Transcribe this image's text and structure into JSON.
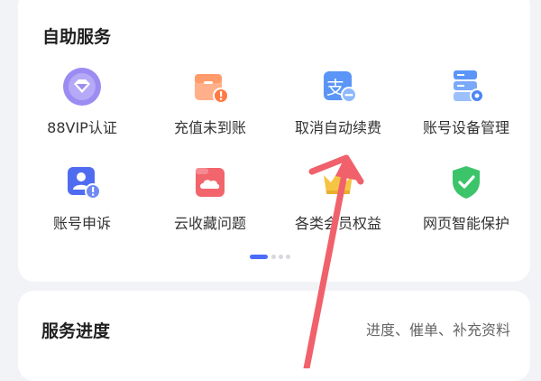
{
  "services": {
    "title": "自助服务",
    "items": [
      {
        "label": "88VIP认证",
        "icon": "vip-diamond-icon"
      },
      {
        "label": "充值未到账",
        "icon": "wallet-alert-icon"
      },
      {
        "label": "取消自动续费",
        "icon": "alipay-minus-icon"
      },
      {
        "label": "账号设备管理",
        "icon": "device-server-icon"
      },
      {
        "label": "账号申诉",
        "icon": "account-appeal-icon"
      },
      {
        "label": "云收藏问题",
        "icon": "cloud-folder-icon"
      },
      {
        "label": "各类会员权益",
        "icon": "crown-icon"
      },
      {
        "label": "网页智能保护",
        "icon": "shield-check-icon"
      }
    ]
  },
  "pagination": {
    "pages": 4,
    "current": 1
  },
  "progress": {
    "title": "服务进度",
    "subtitle": "进度、催单、补充资料"
  },
  "colors": {
    "accent": "#4b6cff",
    "arrow": "#f0616b",
    "vip": "#8f7df0",
    "orange": "#ff8c5a",
    "blue": "#4b86f5",
    "red": "#f2656d",
    "gold": "#f6c445",
    "green": "#3cc46a"
  }
}
